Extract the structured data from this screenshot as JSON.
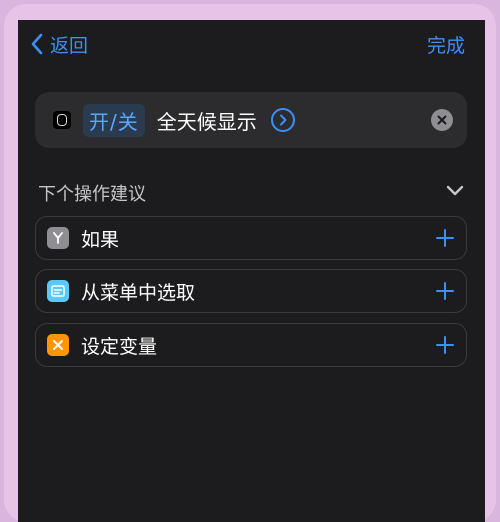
{
  "nav": {
    "back_label": "返回",
    "done_label": "完成"
  },
  "action": {
    "toggle_label": "开/关",
    "text": "全天候显示"
  },
  "suggestions": {
    "title": "下个操作建议",
    "items": [
      {
        "label": "如果",
        "icon": "branch-icon",
        "icon_color": "#8e8e93"
      },
      {
        "label": "从菜单中选取",
        "icon": "menu-icon",
        "icon_color": "#5ac8fa"
      },
      {
        "label": "设定变量",
        "icon": "variable-x-icon",
        "icon_color": "#ff9500"
      }
    ]
  },
  "colors": {
    "accent": "#3b8ff6",
    "background": "#1c1c1e"
  }
}
